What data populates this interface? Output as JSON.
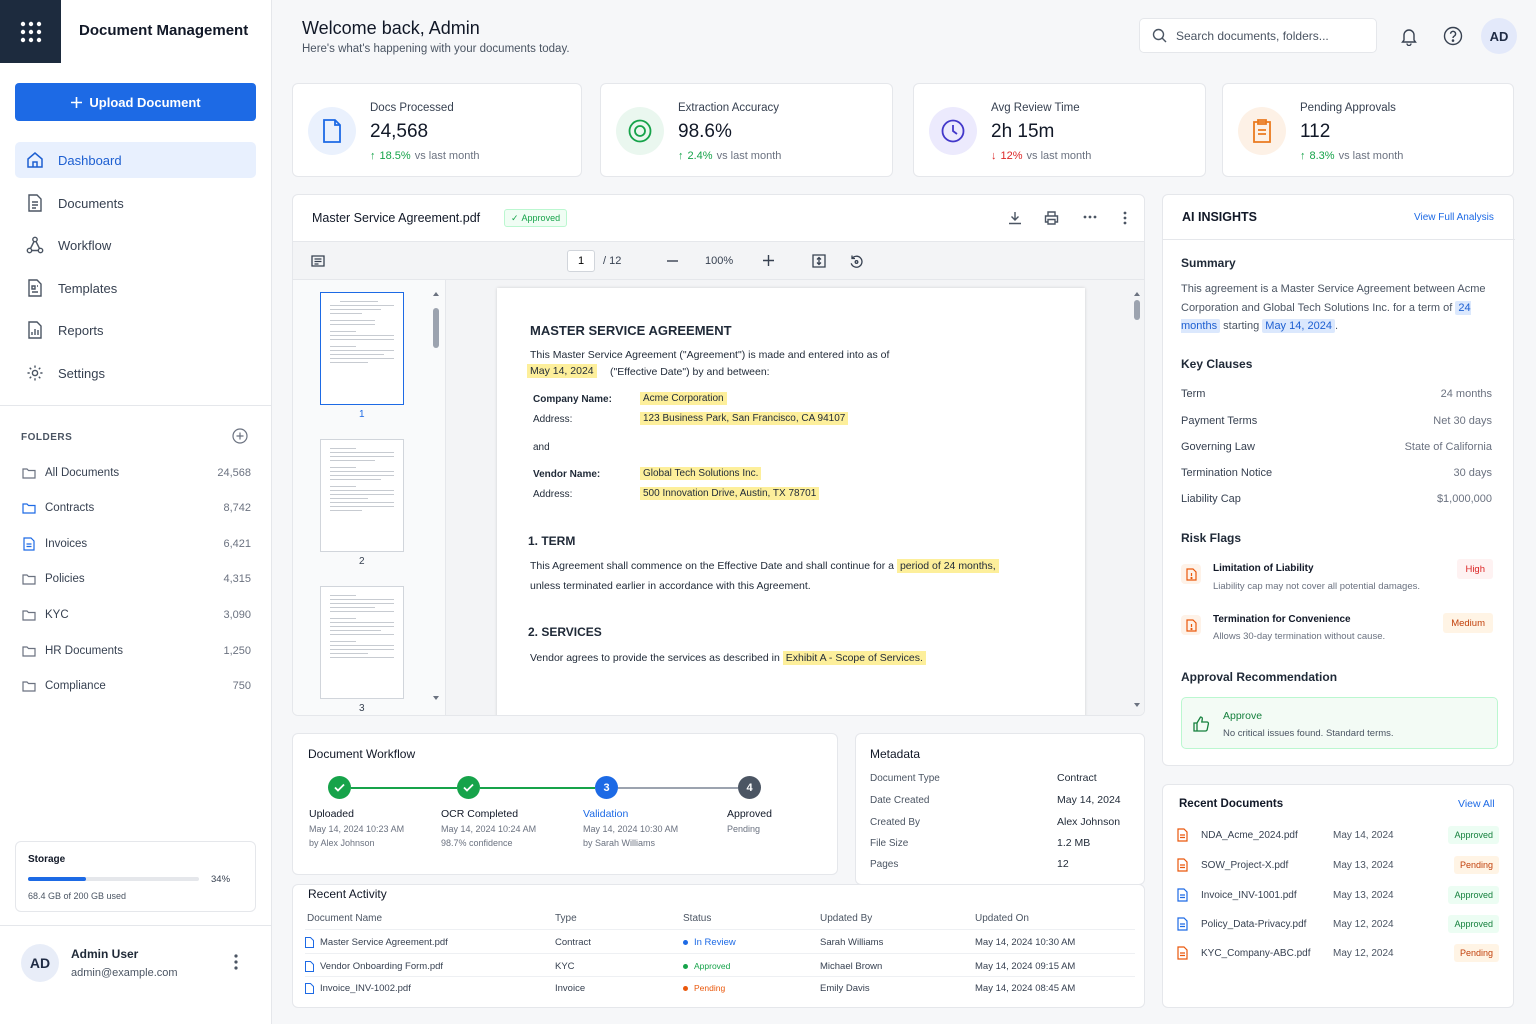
{
  "app": {
    "title": "Document Management",
    "upload_label": "Upload Document"
  },
  "nav": [
    {
      "label": "Dashboard",
      "icon": "home-icon"
    },
    {
      "label": "Documents",
      "icon": "document-icon"
    },
    {
      "label": "Workflow",
      "icon": "workflow-icon"
    },
    {
      "label": "Templates",
      "icon": "template-icon"
    },
    {
      "label": "Reports",
      "icon": "reports-icon"
    },
    {
      "label": "Settings",
      "icon": "gear-icon"
    }
  ],
  "folders": {
    "header": "FOLDERS",
    "items": [
      {
        "label": "All Documents",
        "count": "24,568"
      },
      {
        "label": "Contracts",
        "count": "8,742"
      },
      {
        "label": "Invoices",
        "count": "6,421"
      },
      {
        "label": "Policies",
        "count": "4,315"
      },
      {
        "label": "KYC",
        "count": "3,090"
      },
      {
        "label": "HR Documents",
        "count": "1,250"
      },
      {
        "label": "Compliance",
        "count": "750"
      }
    ]
  },
  "storage": {
    "label": "Storage",
    "percent_text": "34%",
    "percent": 34,
    "used": "68.4 GB of 200 GB used"
  },
  "user": {
    "initials": "AD",
    "name": "Admin User",
    "email": "admin@example.com"
  },
  "header": {
    "welcome": "Welcome back, Admin",
    "subtitle": "Here's what's happening with your documents today.",
    "search_placeholder": "Search documents, folders...",
    "avatar": "AD"
  },
  "stats": [
    {
      "label": "Docs Processed",
      "value": "24,568",
      "delta": "18.5%",
      "delta_dir": "up",
      "suffix": "vs last month",
      "color": "#1d6ae5",
      "bg": "#eaf1fd"
    },
    {
      "label": "Extraction Accuracy",
      "value": "98.6%",
      "delta": "2.4%",
      "delta_dir": "up",
      "suffix": "vs last month",
      "color": "#16a34a",
      "bg": "#eaf7ef"
    },
    {
      "label": "Avg Review Time",
      "value": "2h 15m",
      "delta": "12%",
      "delta_dir": "down",
      "suffix": "vs last month",
      "color": "#4f46e5",
      "bg": "#eceafd"
    },
    {
      "label": "Pending Approvals",
      "value": "112",
      "delta": "8.3%",
      "delta_dir": "up",
      "suffix": "vs last month",
      "color": "#ea7a1f",
      "bg": "#fdf1e6"
    }
  ],
  "viewer": {
    "filename": "Master Service Agreement.pdf",
    "status": "Approved",
    "page": "1",
    "total": "/ 12",
    "zoom": "100%",
    "thumbs": [
      "1",
      "2",
      "3"
    ],
    "doc": {
      "title": "MASTER SERVICE AGREEMENT",
      "intro": "This Master Service Agreement (\"Agreement\") is made and entered into as of",
      "date": "May 14, 2024",
      "intro2": "(\"Effective Date\") by and between:",
      "company_label": "Company Name:",
      "company": "Acme Corporation",
      "addr_label": "Address:",
      "company_addr": "123 Business Park, San Francisco, CA 94107",
      "and": "and",
      "vendor_label": "Vendor Name:",
      "vendor": "Global Tech Solutions Inc.",
      "vendor_addr": "500 Innovation Drive, Austin, TX 78701",
      "s1": "1. TERM",
      "s1_text": "This Agreement shall commence on the Effective Date and shall continue for a",
      "s1_hl": "period of 24 months,",
      "s1_text2": "unless terminated earlier in accordance with this Agreement.",
      "s2": "2. SERVICES",
      "s2_text": "Vendor agrees to provide the services as described in",
      "s2_hl": "Exhibit A - Scope of Services."
    }
  },
  "workflow": {
    "title": "Document Workflow",
    "steps": [
      {
        "num": "",
        "label": "Uploaded",
        "time": "May 14, 2024 10:23 AM",
        "by": "by Alex Johnson"
      },
      {
        "num": "",
        "label": "OCR Completed",
        "time": "May 14, 2024 10:24 AM",
        "by": "98.7% confidence"
      },
      {
        "num": "3",
        "label": "Validation",
        "time": "May 14, 2024 10:30 AM",
        "by": "by Sarah Williams"
      },
      {
        "num": "4",
        "label": "Approved",
        "time": "Pending",
        "by": ""
      }
    ]
  },
  "metadata": {
    "title": "Metadata",
    "rows": [
      {
        "k": "Document Type",
        "v": "Contract"
      },
      {
        "k": "Date Created",
        "v": "May 14, 2024"
      },
      {
        "k": "Created By",
        "v": "Alex Johnson"
      },
      {
        "k": "File Size",
        "v": "1.2 MB"
      },
      {
        "k": "Pages",
        "v": "12"
      }
    ]
  },
  "activity": {
    "title": "Recent Activity",
    "headers": [
      "Document Name",
      "Type",
      "Status",
      "Updated By",
      "Updated On"
    ],
    "rows": [
      {
        "name": "Master Service Agreement.pdf",
        "type": "Contract",
        "status": "In Review",
        "by": "Sarah Williams",
        "on": "May 14, 2024 10:30 AM"
      },
      {
        "name": "Vendor Onboarding Form.pdf",
        "type": "KYC",
        "status": "Approved",
        "by": "Michael Brown",
        "on": "May 14, 2024 09:15 AM"
      },
      {
        "name": "Invoice_INV-1002.pdf",
        "type": "Invoice",
        "status": "Pending",
        "by": "Emily Davis",
        "on": "May 14, 2024 08:45 AM"
      }
    ]
  },
  "ai": {
    "title": "AI INSIGHTS",
    "view_link": "View Full Analysis",
    "summary_title": "Summary",
    "summary_a": "This agreement is a Master Service Agreement between Acme Corporation and Global Tech Solutions Inc. for a term of",
    "summary_term": "24 months",
    "summary_b": "starting",
    "summary_date": "May 14, 2024",
    "summary_c": ".",
    "clauses_title": "Key Clauses",
    "clauses": [
      {
        "k": "Term",
        "v": "24 months"
      },
      {
        "k": "Payment Terms",
        "v": "Net 30 days"
      },
      {
        "k": "Governing Law",
        "v": "State of California"
      },
      {
        "k": "Termination Notice",
        "v": "30 days"
      },
      {
        "k": "Liability Cap",
        "v": "$1,000,000"
      }
    ],
    "risk_title": "Risk Flags",
    "risks": [
      {
        "title": "Limitation of Liability",
        "desc": "Liability cap may not cover all potential damages.",
        "level": "High"
      },
      {
        "title": "Termination for Convenience",
        "desc": "Allows 30-day termination without cause.",
        "level": "Medium"
      }
    ],
    "rec_title": "Approval Recommendation",
    "rec_label": "Approve",
    "rec_desc": "No critical issues found. Standard terms."
  },
  "recent": {
    "title": "Recent Documents",
    "view_link": "View All",
    "rows": [
      {
        "name": "NDA_Acme_2024.pdf",
        "date": "May 14, 2024",
        "status": "Approved",
        "color": "#ea580c"
      },
      {
        "name": "SOW_Project-X.pdf",
        "date": "May 13, 2024",
        "status": "Pending",
        "color": "#ea580c"
      },
      {
        "name": "Invoice_INV-1001.pdf",
        "date": "May 13, 2024",
        "status": "Approved",
        "color": "#1d6ae5"
      },
      {
        "name": "Policy_Data-Privacy.pdf",
        "date": "May 12, 2024",
        "status": "Approved",
        "color": "#1d6ae5"
      },
      {
        "name": "KYC_Company-ABC.pdf",
        "date": "May 12, 2024",
        "status": "Pending",
        "color": "#ea580c"
      }
    ]
  }
}
